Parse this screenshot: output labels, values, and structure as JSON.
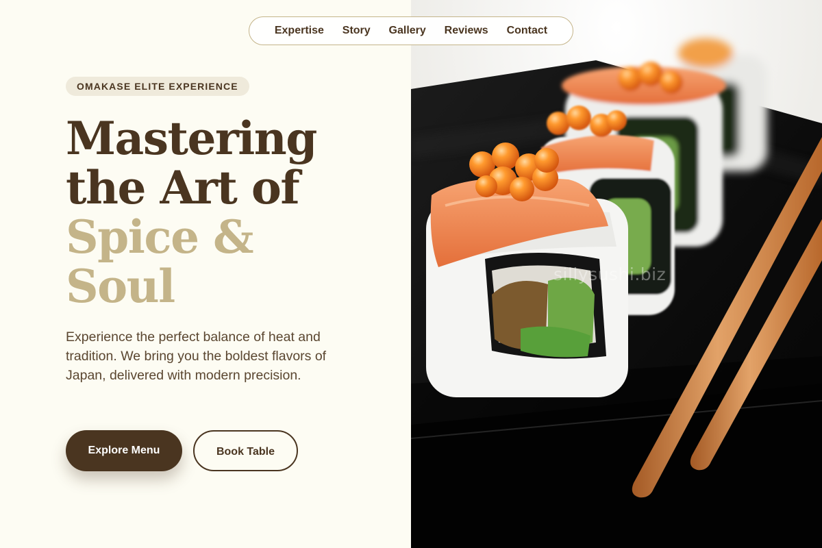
{
  "nav": {
    "items": [
      {
        "label": "Expertise"
      },
      {
        "label": "Story"
      },
      {
        "label": "Gallery"
      },
      {
        "label": "Reviews"
      },
      {
        "label": "Contact"
      }
    ]
  },
  "hero": {
    "eyebrow": "OMAKASE ELITE EXPERIENCE",
    "headline": {
      "line1": "Mastering",
      "line2": "the Art of",
      "line3": "Spice &",
      "line4": "Soul"
    },
    "lead": "Experience the perfect balance of heat and tradition. We bring you the boldest flavors of Japan, delivered with modern precision.",
    "primary_cta": "Explore Menu",
    "secondary_cta": "Book Table"
  },
  "image": {
    "subject": "sushi rolls topped with salmon and roe on a black plate with chopsticks",
    "watermark": "sillysushi.biz"
  },
  "colors": {
    "background": "#fdfcf3",
    "brown": "#4a3520",
    "gold": "#c4b489",
    "pill": "#efeadb"
  }
}
